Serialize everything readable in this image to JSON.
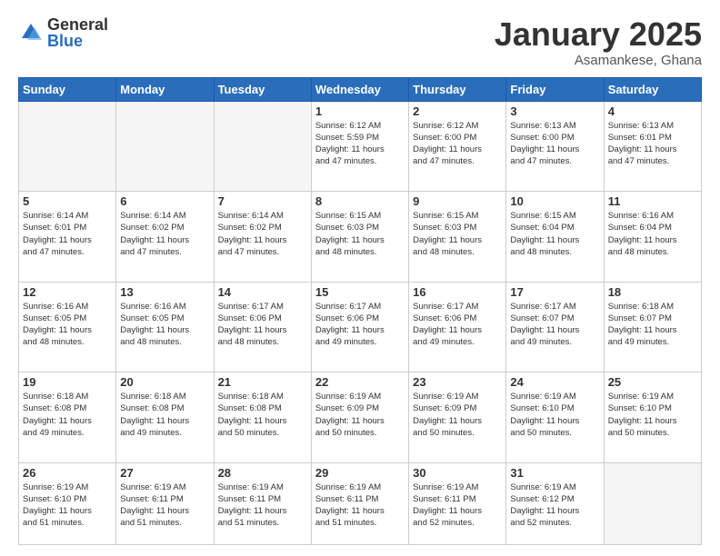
{
  "header": {
    "logo_general": "General",
    "logo_blue": "Blue",
    "month_year": "January 2025",
    "location": "Asamankese, Ghana"
  },
  "days_of_week": [
    "Sunday",
    "Monday",
    "Tuesday",
    "Wednesday",
    "Thursday",
    "Friday",
    "Saturday"
  ],
  "weeks": [
    [
      {
        "day": "",
        "info": ""
      },
      {
        "day": "",
        "info": ""
      },
      {
        "day": "",
        "info": ""
      },
      {
        "day": "1",
        "info": "Sunrise: 6:12 AM\nSunset: 5:59 PM\nDaylight: 11 hours\nand 47 minutes."
      },
      {
        "day": "2",
        "info": "Sunrise: 6:12 AM\nSunset: 6:00 PM\nDaylight: 11 hours\nand 47 minutes."
      },
      {
        "day": "3",
        "info": "Sunrise: 6:13 AM\nSunset: 6:00 PM\nDaylight: 11 hours\nand 47 minutes."
      },
      {
        "day": "4",
        "info": "Sunrise: 6:13 AM\nSunset: 6:01 PM\nDaylight: 11 hours\nand 47 minutes."
      }
    ],
    [
      {
        "day": "5",
        "info": "Sunrise: 6:14 AM\nSunset: 6:01 PM\nDaylight: 11 hours\nand 47 minutes."
      },
      {
        "day": "6",
        "info": "Sunrise: 6:14 AM\nSunset: 6:02 PM\nDaylight: 11 hours\nand 47 minutes."
      },
      {
        "day": "7",
        "info": "Sunrise: 6:14 AM\nSunset: 6:02 PM\nDaylight: 11 hours\nand 47 minutes."
      },
      {
        "day": "8",
        "info": "Sunrise: 6:15 AM\nSunset: 6:03 PM\nDaylight: 11 hours\nand 48 minutes."
      },
      {
        "day": "9",
        "info": "Sunrise: 6:15 AM\nSunset: 6:03 PM\nDaylight: 11 hours\nand 48 minutes."
      },
      {
        "day": "10",
        "info": "Sunrise: 6:15 AM\nSunset: 6:04 PM\nDaylight: 11 hours\nand 48 minutes."
      },
      {
        "day": "11",
        "info": "Sunrise: 6:16 AM\nSunset: 6:04 PM\nDaylight: 11 hours\nand 48 minutes."
      }
    ],
    [
      {
        "day": "12",
        "info": "Sunrise: 6:16 AM\nSunset: 6:05 PM\nDaylight: 11 hours\nand 48 minutes."
      },
      {
        "day": "13",
        "info": "Sunrise: 6:16 AM\nSunset: 6:05 PM\nDaylight: 11 hours\nand 48 minutes."
      },
      {
        "day": "14",
        "info": "Sunrise: 6:17 AM\nSunset: 6:06 PM\nDaylight: 11 hours\nand 48 minutes."
      },
      {
        "day": "15",
        "info": "Sunrise: 6:17 AM\nSunset: 6:06 PM\nDaylight: 11 hours\nand 49 minutes."
      },
      {
        "day": "16",
        "info": "Sunrise: 6:17 AM\nSunset: 6:06 PM\nDaylight: 11 hours\nand 49 minutes."
      },
      {
        "day": "17",
        "info": "Sunrise: 6:17 AM\nSunset: 6:07 PM\nDaylight: 11 hours\nand 49 minutes."
      },
      {
        "day": "18",
        "info": "Sunrise: 6:18 AM\nSunset: 6:07 PM\nDaylight: 11 hours\nand 49 minutes."
      }
    ],
    [
      {
        "day": "19",
        "info": "Sunrise: 6:18 AM\nSunset: 6:08 PM\nDaylight: 11 hours\nand 49 minutes."
      },
      {
        "day": "20",
        "info": "Sunrise: 6:18 AM\nSunset: 6:08 PM\nDaylight: 11 hours\nand 49 minutes."
      },
      {
        "day": "21",
        "info": "Sunrise: 6:18 AM\nSunset: 6:08 PM\nDaylight: 11 hours\nand 50 minutes."
      },
      {
        "day": "22",
        "info": "Sunrise: 6:19 AM\nSunset: 6:09 PM\nDaylight: 11 hours\nand 50 minutes."
      },
      {
        "day": "23",
        "info": "Sunrise: 6:19 AM\nSunset: 6:09 PM\nDaylight: 11 hours\nand 50 minutes."
      },
      {
        "day": "24",
        "info": "Sunrise: 6:19 AM\nSunset: 6:10 PM\nDaylight: 11 hours\nand 50 minutes."
      },
      {
        "day": "25",
        "info": "Sunrise: 6:19 AM\nSunset: 6:10 PM\nDaylight: 11 hours\nand 50 minutes."
      }
    ],
    [
      {
        "day": "26",
        "info": "Sunrise: 6:19 AM\nSunset: 6:10 PM\nDaylight: 11 hours\nand 51 minutes."
      },
      {
        "day": "27",
        "info": "Sunrise: 6:19 AM\nSunset: 6:11 PM\nDaylight: 11 hours\nand 51 minutes."
      },
      {
        "day": "28",
        "info": "Sunrise: 6:19 AM\nSunset: 6:11 PM\nDaylight: 11 hours\nand 51 minutes."
      },
      {
        "day": "29",
        "info": "Sunrise: 6:19 AM\nSunset: 6:11 PM\nDaylight: 11 hours\nand 51 minutes."
      },
      {
        "day": "30",
        "info": "Sunrise: 6:19 AM\nSunset: 6:11 PM\nDaylight: 11 hours\nand 52 minutes."
      },
      {
        "day": "31",
        "info": "Sunrise: 6:19 AM\nSunset: 6:12 PM\nDaylight: 11 hours\nand 52 minutes."
      },
      {
        "day": "",
        "info": ""
      }
    ]
  ]
}
